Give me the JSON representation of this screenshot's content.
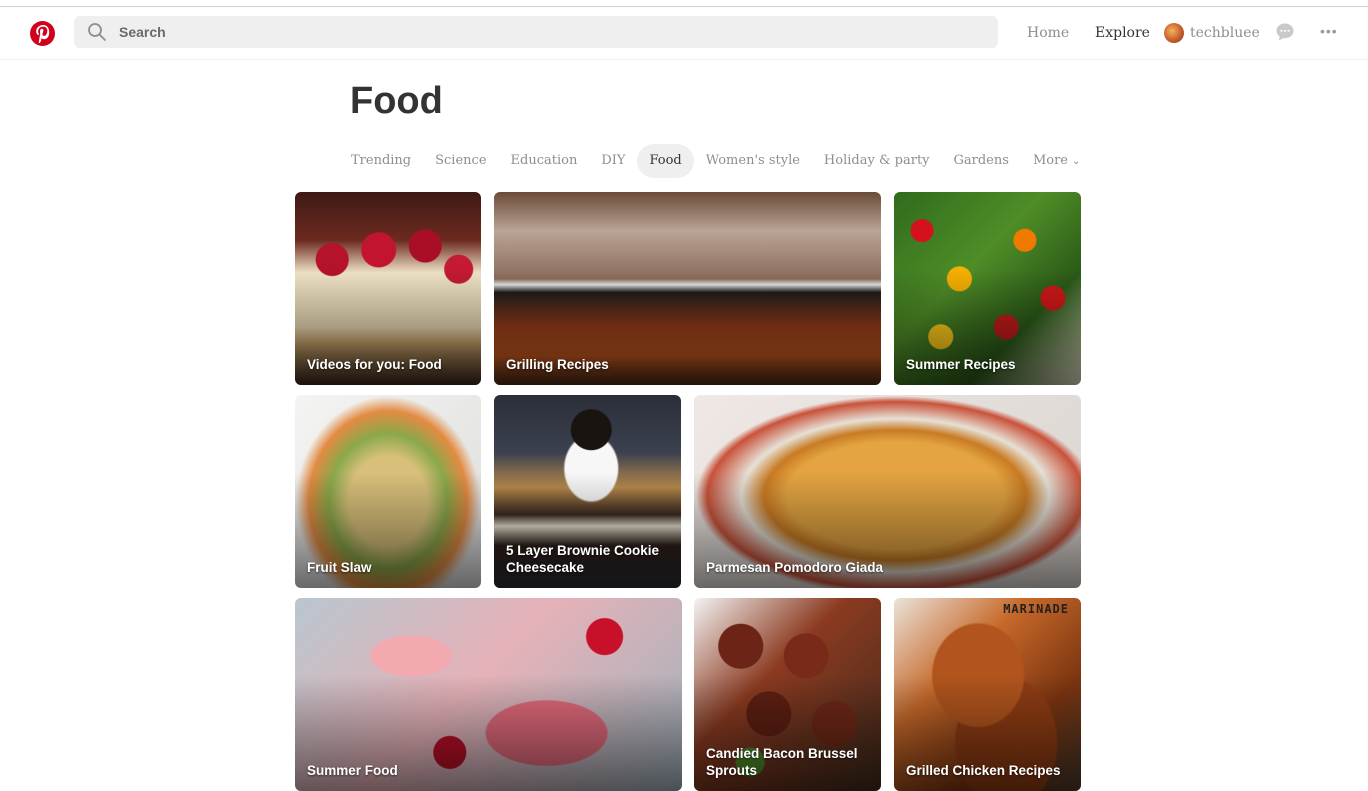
{
  "header": {
    "search_placeholder": "Search",
    "nav_home": "Home",
    "nav_explore": "Explore",
    "username": "techbluee",
    "more_dots": "•••",
    "icons": {
      "logo": "pinterest-logo-icon",
      "search": "search-icon",
      "avatar": "avatar",
      "chat": "chat-bubble-icon",
      "more": "more-dots-icon"
    },
    "colors": {
      "brand": "#d0021b",
      "search_bg": "#efefef"
    }
  },
  "page_title": "Food",
  "tabs": [
    {
      "label": "Trending",
      "active": false
    },
    {
      "label": "Science",
      "active": false
    },
    {
      "label": "Education",
      "active": false
    },
    {
      "label": "DIY",
      "active": false
    },
    {
      "label": "Food",
      "active": true
    },
    {
      "label": "Women's style",
      "active": false
    },
    {
      "label": "Holiday & party",
      "active": false
    },
    {
      "label": "Gardens",
      "active": false
    },
    {
      "label": "More",
      "active": false
    }
  ],
  "tiles": [
    {
      "label": "Videos for you: Food"
    },
    {
      "label": "Grilling Recipes"
    },
    {
      "label": "Summer Recipes"
    },
    {
      "label": "Fruit Slaw"
    },
    {
      "label": "5 Layer Brownie Cookie Cheesecake"
    },
    {
      "label": "Parmesan Pomodoro Giada"
    },
    {
      "label": "Summer Food"
    },
    {
      "label": "Candied Bacon Brussel Sprouts"
    },
    {
      "label": "Grilled Chicken Recipes",
      "stamp": "MARINADE"
    }
  ]
}
